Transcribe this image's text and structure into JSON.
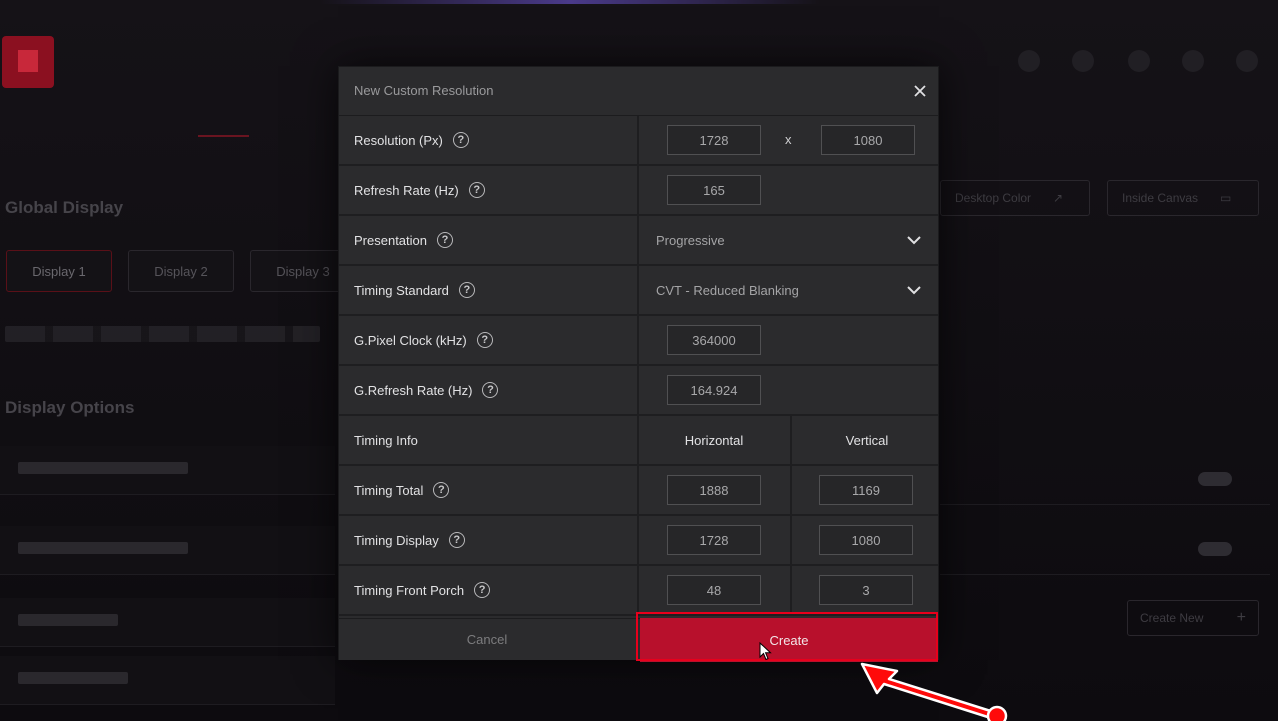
{
  "background_app": {
    "section_global": "Global Display",
    "section_options": "Display Options",
    "display_tabs": [
      "Display 1",
      "Display 2",
      "Display 3"
    ],
    "right_buttons": [
      "Desktop Color",
      "Inside Canvas"
    ],
    "create_new_label": "Create New"
  },
  "dialog": {
    "title": "New Custom Resolution",
    "rows": {
      "resolution": {
        "label": "Resolution (Px)",
        "width": "1728",
        "sep": "x",
        "height": "1080"
      },
      "refresh_rate": {
        "label": "Refresh Rate (Hz)",
        "value": "165"
      },
      "presentation": {
        "label": "Presentation",
        "value": "Progressive"
      },
      "timing_standard": {
        "label": "Timing Standard",
        "value": "CVT - Reduced Blanking"
      },
      "pixel_clock": {
        "label": "G.Pixel Clock (kHz)",
        "value": "364000"
      },
      "g_refresh_rate": {
        "label": "G.Refresh Rate (Hz)",
        "value": "164.924"
      },
      "timing_info": {
        "label": "Timing Info",
        "col_horizontal": "Horizontal",
        "col_vertical": "Vertical"
      },
      "timing_total": {
        "label": "Timing Total",
        "h": "1888",
        "v": "1169"
      },
      "timing_display": {
        "label": "Timing Display",
        "h": "1728",
        "v": "1080"
      },
      "timing_front_porch": {
        "label": "Timing Front Porch",
        "h": "48",
        "v": "3"
      }
    },
    "cancel_label": "Cancel",
    "create_label": "Create"
  },
  "colors": {
    "accent": "#b8102c",
    "highlight": "#e8001c"
  },
  "icons": [
    "close-icon",
    "help-icon",
    "chevron-down-icon",
    "mouse-cursor-icon",
    "annotation-arrow"
  ]
}
